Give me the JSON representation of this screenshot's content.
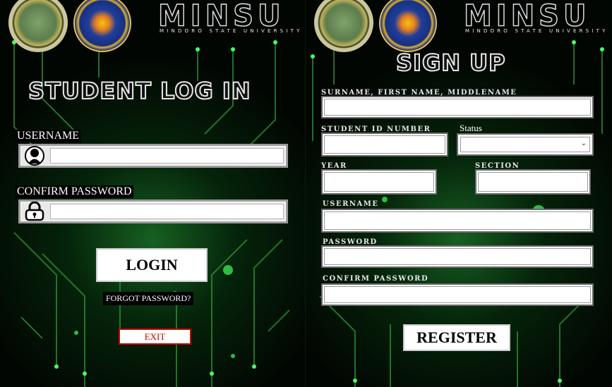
{
  "left_panel": {
    "brand": {
      "name": "MINSU",
      "subtitle": "MINDORO STATE UNIVERSITY"
    },
    "title": "STUDENT LOG IN",
    "username_label": "USERNAME",
    "password_label": "CONFIRM PASSWORD",
    "username_value": "",
    "password_value": "",
    "login_button": "LOGIN",
    "forgot_link": "FORGOT PASSWORD?",
    "exit_button": "EXIT"
  },
  "right_panel": {
    "brand": {
      "name": "MINSU",
      "subtitle": "MINDORO STATE UNIVERSITY"
    },
    "title": "SIGN UP",
    "fields": {
      "fullname_label": "SURNAME, FIRST NAME, MIDDLENAME",
      "student_id_label": "STUDENT ID NUMBER",
      "status_label": "Status",
      "status_selected": "",
      "year_label": "YEAR",
      "section_label": "SECTION",
      "username_label": "USERNAME",
      "password_label": "PASSWORD",
      "confirm_password_label": "CONFIRM PASSWORD"
    },
    "register_button": "REGISTER"
  },
  "colors": {
    "accent_green": "#3cff5a",
    "exit_red": "#cc0000"
  },
  "icons": [
    "user-icon",
    "lock-icon",
    "chevron-down-icon",
    "college-seal-logo",
    "university-seal-logo"
  ]
}
